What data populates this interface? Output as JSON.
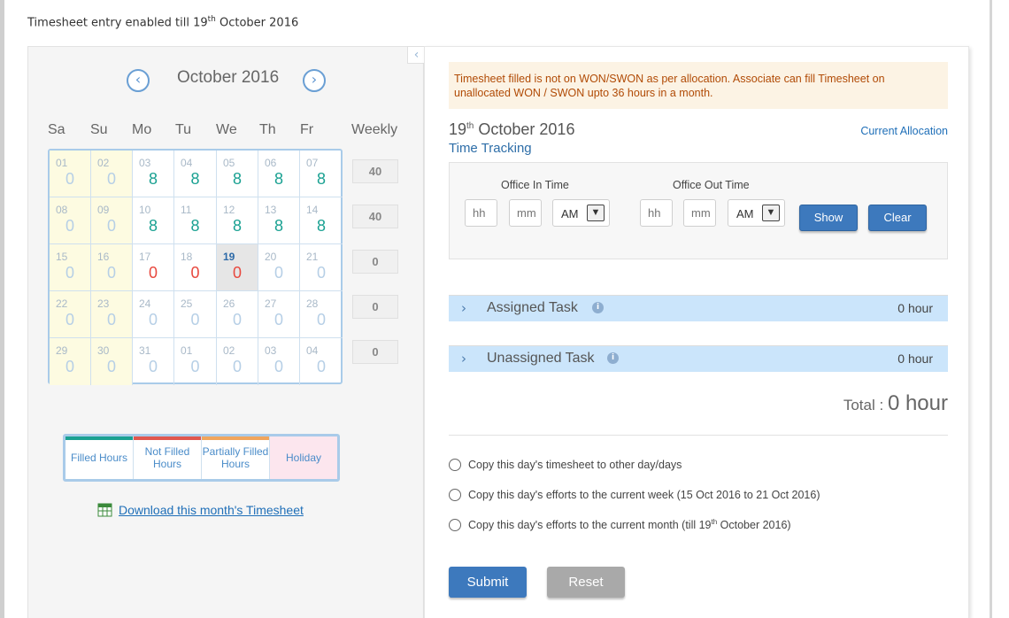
{
  "header": {
    "note_prefix": "Timesheet entry enabled till 19",
    "note_sup": "th",
    "note_suffix": " October 2016"
  },
  "calendar": {
    "month_title": "October 2016",
    "prev_icon": "chevron-left-icon",
    "next_icon": "chevron-right-icon",
    "days_of_week": [
      "Sa",
      "Su",
      "Mo",
      "Tu",
      "We",
      "Th",
      "Fr"
    ],
    "weekly_label": "Weekly",
    "weeks": [
      {
        "weekly": "40",
        "days": [
          {
            "d": "01",
            "h": "0",
            "s": "weekend"
          },
          {
            "d": "02",
            "h": "0",
            "s": "weekend"
          },
          {
            "d": "03",
            "h": "8",
            "s": "filled"
          },
          {
            "d": "04",
            "h": "8",
            "s": "filled"
          },
          {
            "d": "05",
            "h": "8",
            "s": "filled"
          },
          {
            "d": "06",
            "h": "8",
            "s": "filled"
          },
          {
            "d": "07",
            "h": "8",
            "s": "filled"
          }
        ]
      },
      {
        "weekly": "40",
        "days": [
          {
            "d": "08",
            "h": "0",
            "s": "weekend"
          },
          {
            "d": "09",
            "h": "0",
            "s": "weekend"
          },
          {
            "d": "10",
            "h": "8",
            "s": "filled"
          },
          {
            "d": "11",
            "h": "8",
            "s": "filled"
          },
          {
            "d": "12",
            "h": "8",
            "s": "filled"
          },
          {
            "d": "13",
            "h": "8",
            "s": "filled"
          },
          {
            "d": "14",
            "h": "8",
            "s": "filled"
          }
        ]
      },
      {
        "weekly": "0",
        "days": [
          {
            "d": "15",
            "h": "0",
            "s": "weekend"
          },
          {
            "d": "16",
            "h": "0",
            "s": "weekend"
          },
          {
            "d": "17",
            "h": "0",
            "s": "notfilled"
          },
          {
            "d": "18",
            "h": "0",
            "s": "notfilled"
          },
          {
            "d": "19",
            "h": "0",
            "s": "today"
          },
          {
            "d": "20",
            "h": "0",
            "s": "future"
          },
          {
            "d": "21",
            "h": "0",
            "s": "future"
          }
        ]
      },
      {
        "weekly": "0",
        "days": [
          {
            "d": "22",
            "h": "0",
            "s": "weekend"
          },
          {
            "d": "23",
            "h": "0",
            "s": "weekend"
          },
          {
            "d": "24",
            "h": "0",
            "s": "future"
          },
          {
            "d": "25",
            "h": "0",
            "s": "future"
          },
          {
            "d": "26",
            "h": "0",
            "s": "future"
          },
          {
            "d": "27",
            "h": "0",
            "s": "future"
          },
          {
            "d": "28",
            "h": "0",
            "s": "future"
          }
        ]
      },
      {
        "weekly": "0",
        "days": [
          {
            "d": "29",
            "h": "0",
            "s": "weekend"
          },
          {
            "d": "30",
            "h": "0",
            "s": "weekend"
          },
          {
            "d": "31",
            "h": "0",
            "s": "future"
          },
          {
            "d": "01",
            "h": "0",
            "s": "future"
          },
          {
            "d": "02",
            "h": "0",
            "s": "future"
          },
          {
            "d": "03",
            "h": "0",
            "s": "future"
          },
          {
            "d": "04",
            "h": "0",
            "s": "future"
          }
        ]
      }
    ]
  },
  "legend": [
    {
      "label": "Filled Hours",
      "color": "#1aa192"
    },
    {
      "label": "Not Filled Hours",
      "color": "#e0574e"
    },
    {
      "label": "Partially Filled Hours",
      "color": "#f0a55d"
    },
    {
      "label": "Holiday",
      "color": "#fce6ee"
    }
  ],
  "download": {
    "label": "Download this month's Timesheet",
    "icon": "excel-icon"
  },
  "panel": {
    "warning": "Timesheet filled is not on WON/SWON as per allocation. Associate can fill Timesheet on unallocated WON / SWON upto 36 hours in a month.",
    "date_day": "19",
    "date_sup": "th",
    "date_rest": " October 2016",
    "time_tracking": "Time Tracking",
    "current_allocation": "Current Allocation",
    "office_in_label": "Office In Time",
    "office_out_label": "Office Out Time",
    "hh_placeholder": "hh",
    "mm_placeholder": "mm",
    "ampm_in": "AM",
    "ampm_out": "AM",
    "show_label": "Show",
    "clear_label": "Clear",
    "assigned_task": "Assigned Task",
    "assigned_hours": "0 hour",
    "unassigned_task": "Unassigned Task",
    "unassigned_hours": "0 hour",
    "total_label": "Total : ",
    "total_value": "0  hour",
    "copy_day": "Copy this day's timesheet to other day/days",
    "copy_week": "Copy this day's efforts to the current week (15 Oct 2016 to 21 Oct 2016)",
    "copy_month_prefix": "Copy this day's efforts to the current month (till 19",
    "copy_month_sup": "th",
    "copy_month_suffix": " October 2016)",
    "submit_label": "Submit",
    "reset_label": "Reset"
  }
}
